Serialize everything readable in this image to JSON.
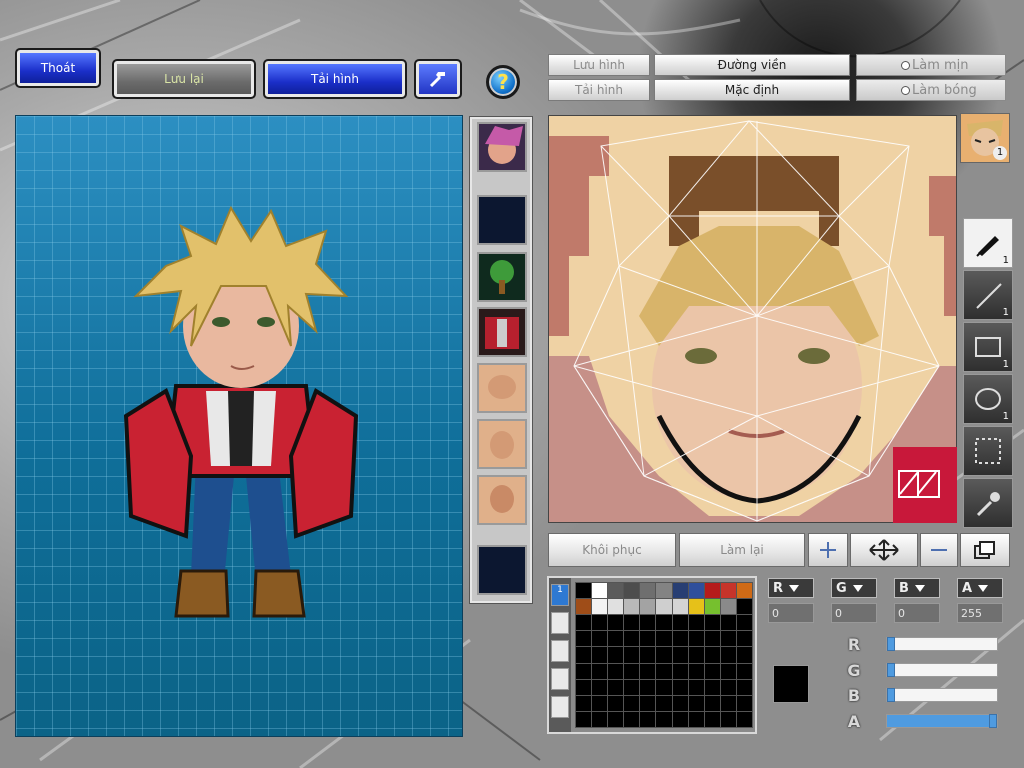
{
  "toolbar": {
    "exit_label": "Thoát",
    "save_label": "Lưu lại",
    "load_label": "Tải hình",
    "hammer_icon": "hammer-icon",
    "help_label": "?"
  },
  "editor": {
    "save_image_label": "Lưu hình",
    "load_image_label": "Tải hình",
    "outline_label": "Đường viền",
    "default_label": "Mặc định",
    "smooth_label": "Làm mịn",
    "shade_label": "Làm bóng"
  },
  "actions": {
    "restore_label": "Khôi phục",
    "redo_label": "Làm lại"
  },
  "tools": [
    {
      "name": "pen-tool",
      "icon": "pen-icon",
      "count": "1",
      "selected": true
    },
    {
      "name": "line-tool",
      "icon": "line-icon",
      "count": "1"
    },
    {
      "name": "rect-tool",
      "icon": "rectangle-icon",
      "count": "1"
    },
    {
      "name": "ellipse-tool",
      "icon": "ellipse-icon",
      "count": "1"
    },
    {
      "name": "select-tool",
      "icon": "marquee-icon",
      "count": ""
    },
    {
      "name": "eyedropper-tool",
      "icon": "eyedropper-icon",
      "count": ""
    }
  ],
  "face_slot_count": "1",
  "palette": {
    "tab_selected": "1",
    "colors": [
      "#000000",
      "#ffffff",
      "#5b5b5b",
      "#4d4d4d",
      "#6f6f6f",
      "#838383",
      "#273e73",
      "#2f4f9c",
      "#b51b1b",
      "#c6342a",
      "#cf6a16",
      "#9f4d18",
      "#f2f2f2",
      "#e0e0e0",
      "#b9b9b9",
      "#a3a3a3",
      "#cfcfcf",
      "#d4d4d4",
      "#e6c119",
      "#76c02e",
      "#8a8a8a"
    ]
  },
  "color": {
    "r_label": "R",
    "g_label": "G",
    "b_label": "B",
    "a_label": "A",
    "r": "0",
    "g": "0",
    "b": "0",
    "a": "255",
    "r_frac": 0.0,
    "g_frac": 0.0,
    "b_frac": 0.0,
    "a_frac": 1.0,
    "current": "#000000"
  },
  "strip_slots": [
    "portrait",
    "empty",
    "tree",
    "torso",
    "face-1",
    "face-2",
    "face-3",
    "empty"
  ]
}
